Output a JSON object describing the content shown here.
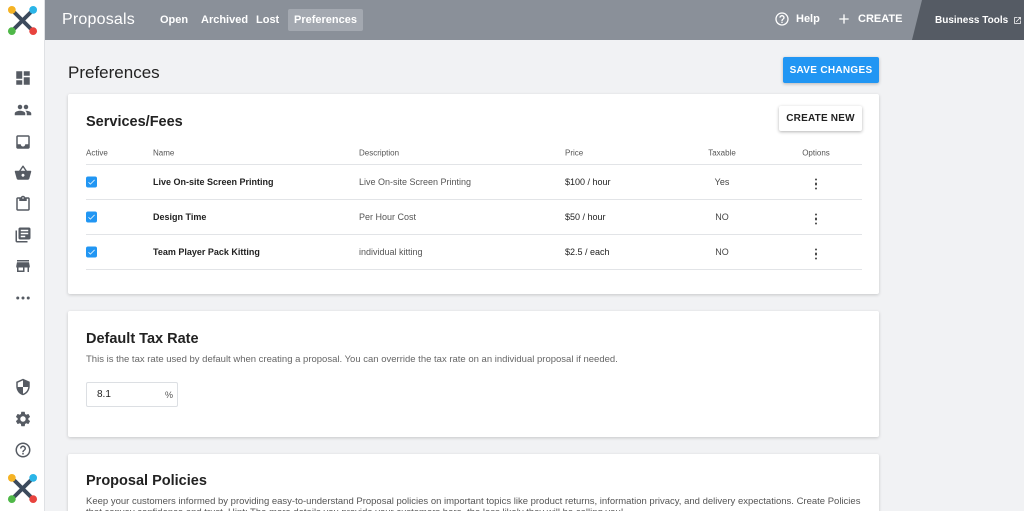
{
  "header": {
    "title": "Proposals",
    "tabs": [
      {
        "label": "Open"
      },
      {
        "label": "Archived"
      },
      {
        "label": "Lost"
      },
      {
        "label": "Preferences",
        "active": true
      }
    ],
    "help_label": "Help",
    "create_label": "CREATE",
    "business_tools_label": "Business Tools"
  },
  "sidebar": {
    "icons": [
      "dashboard-icon",
      "people-icon",
      "inbox-icon",
      "basket-icon",
      "clipboard-icon",
      "library-icon",
      "store-icon",
      "more-icon",
      "shield-icon",
      "gear-icon",
      "help-icon"
    ]
  },
  "page": {
    "title": "Preferences",
    "save_label": "SAVE CHANGES"
  },
  "services": {
    "title": "Services/Fees",
    "create_label": "CREATE NEW",
    "columns": {
      "active": "Active",
      "name": "Name",
      "description": "Description",
      "price": "Price",
      "taxable": "Taxable",
      "options": "Options"
    },
    "rows": [
      {
        "active": true,
        "name": "Live On-site Screen Printing",
        "description": "Live On-site Screen Printing",
        "price": "$100 / hour",
        "taxable": "Yes"
      },
      {
        "active": true,
        "name": "Design Time",
        "description": "Per Hour Cost",
        "price": "$50 / hour",
        "taxable": "NO"
      },
      {
        "active": true,
        "name": "Team Player Pack Kitting",
        "description": "individual kitting",
        "price": "$2.5 / each",
        "taxable": "NO"
      }
    ]
  },
  "tax": {
    "title": "Default Tax Rate",
    "description": "This is the tax rate used by default when creating a proposal. You can override the tax rate on an individual proposal if needed.",
    "value": "8.1",
    "unit": "%"
  },
  "policies": {
    "title": "Proposal Policies",
    "description": "Keep your customers informed by providing easy-to-understand Proposal policies on important topics like product returns, information privacy, and delivery expectations. Create Policies that convey confidence and trust. Hint: The more details you provide your customers here, the less likely they will be calling you!"
  },
  "colors": {
    "accent": "#2196f3",
    "topbar": "#8a9099",
    "business_tools_bg": "#555b64"
  }
}
